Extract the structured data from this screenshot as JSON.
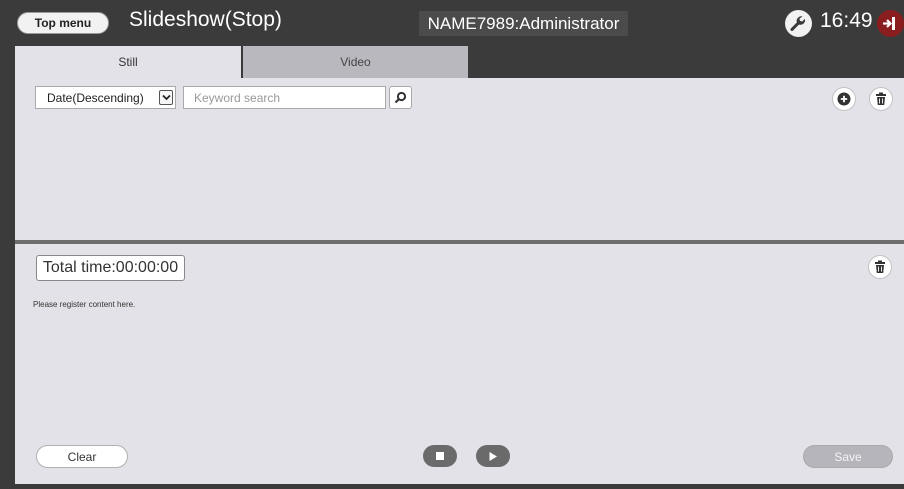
{
  "header": {
    "top_menu_label": "Top menu",
    "title": "Slideshow(Stop)",
    "user": "NAME7989:Administrator",
    "time": "16:49"
  },
  "tabs": [
    {
      "label": "Still",
      "active": true
    },
    {
      "label": "Video",
      "active": false
    }
  ],
  "filter": {
    "sort_selected": "Date(Descending)",
    "search_placeholder": "Keyword search"
  },
  "playlist": {
    "total_time": "Total time:00:00:00",
    "empty_message": "Please register content here.",
    "clear_label": "Clear",
    "save_label": "Save"
  },
  "colors": {
    "background": "#3b3b3b",
    "panel": "#e3e2e8",
    "inactive_tab": "#b9b8be",
    "logout": "#8a1e1e"
  },
  "icons": [
    "wrench-icon",
    "logout-icon",
    "chevron-down-icon",
    "search-icon",
    "add-icon",
    "trash-icon",
    "stop-icon",
    "play-icon"
  ]
}
